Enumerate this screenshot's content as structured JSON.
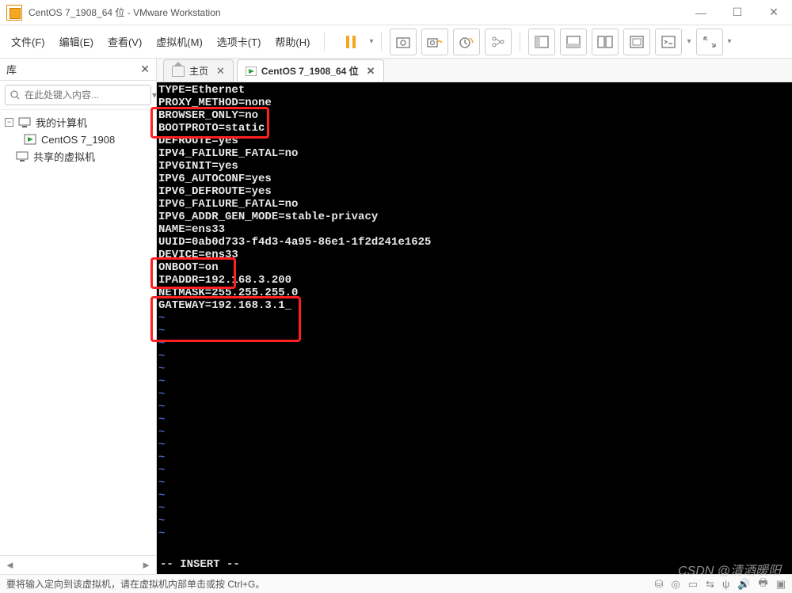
{
  "window": {
    "title": "CentOS 7_1908_64 位 - VMware Workstation"
  },
  "menu": {
    "file": "文件(F)",
    "edit": "编辑(E)",
    "view": "查看(V)",
    "vm": "虚拟机(M)",
    "tabs": "选项卡(T)",
    "help": "帮助(H)"
  },
  "sidebar": {
    "title": "库",
    "search_placeholder": "在此处键入内容...",
    "tree": {
      "root": "我的计算机",
      "vm": "CentOS 7_1908",
      "shared": "共享的虚拟机"
    }
  },
  "tabs": {
    "home": "主页",
    "vm": "CentOS 7_1908_64 位"
  },
  "terminal": {
    "lines": [
      "TYPE=Ethernet",
      "PROXY_METHOD=none",
      "BROWSER_ONLY=no",
      "BOOTPROTO=static",
      "DEFROUTE=yes",
      "IPV4_FAILURE_FATAL=no",
      "IPV6INIT=yes",
      "IPV6_AUTOCONF=yes",
      "IPV6_DEFROUTE=yes",
      "IPV6_FAILURE_FATAL=no",
      "IPV6_ADDR_GEN_MODE=stable-privacy",
      "NAME=ens33",
      "UUID=0ab0d733-f4d3-4a95-86e1-1f2d241e1625",
      "DEVICE=ens33",
      "ONBOOT=on",
      "",
      "IPADDR=192.168.3.200",
      "NETMASK=255.255.255.0",
      "GATEWAY=192.168.3.1_"
    ],
    "status": "-- INSERT --"
  },
  "statusbar": {
    "hint": "要将输入定向到该虚拟机，请在虚拟机内部单击或按 Ctrl+G。"
  },
  "watermark": "CSDN @清酒暖阳"
}
